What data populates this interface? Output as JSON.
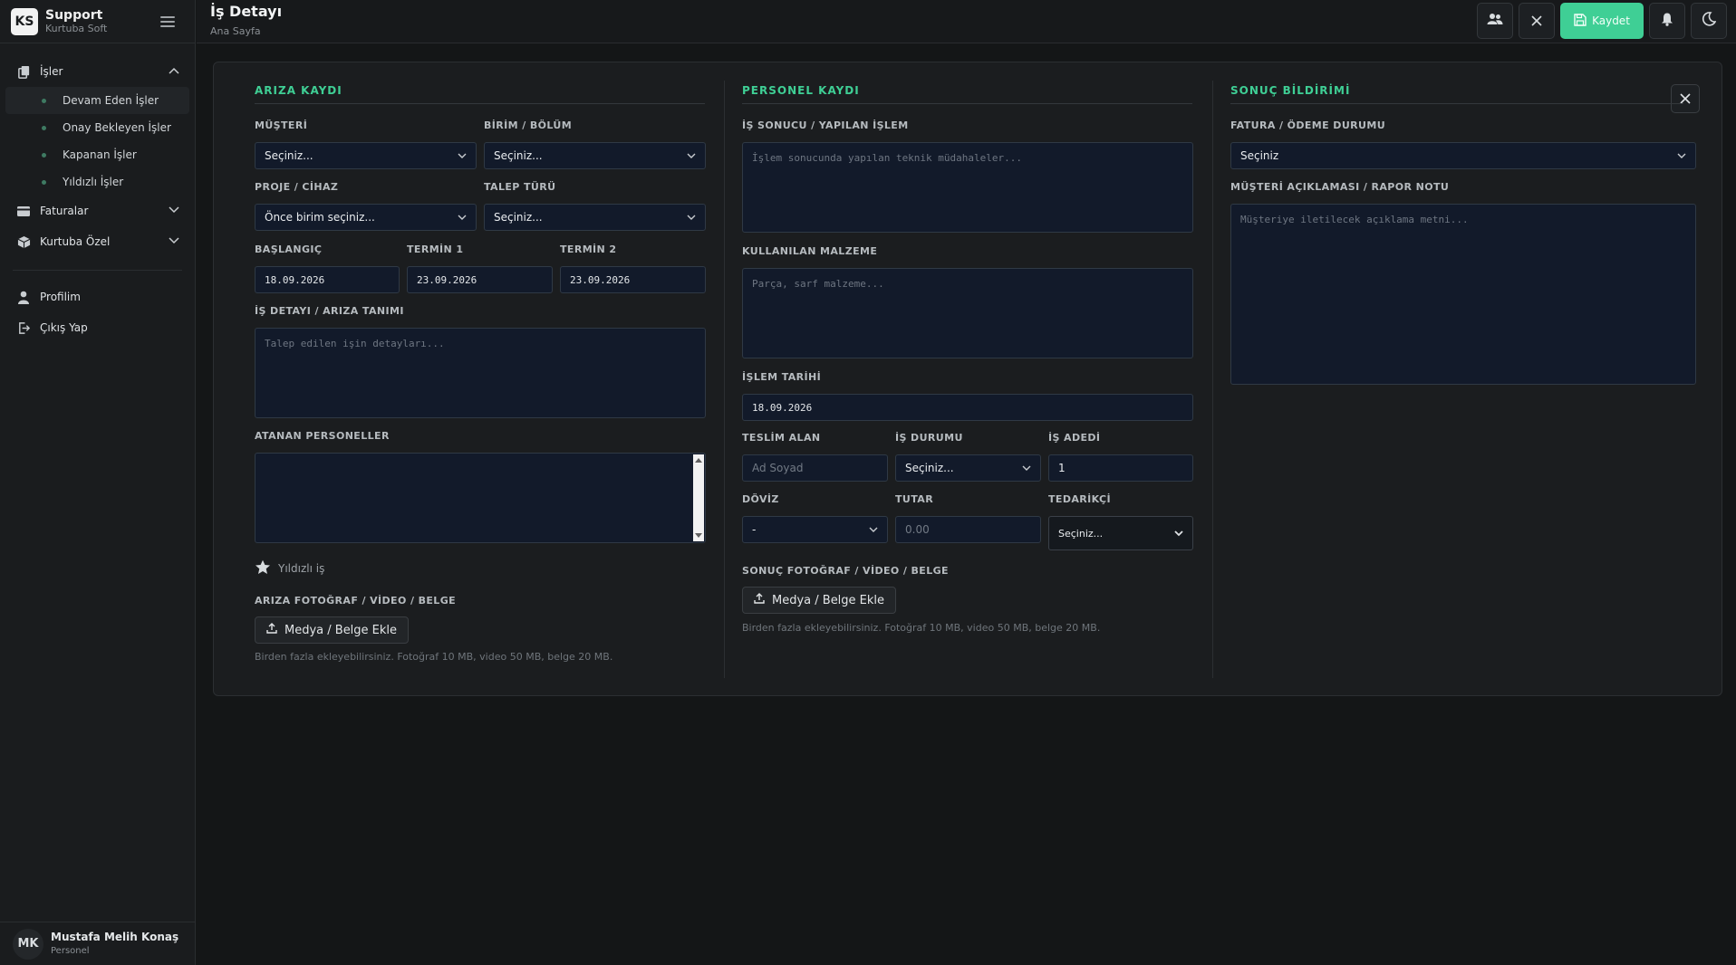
{
  "brand": {
    "title": "Support",
    "subtitle": "Kurtuba Soft",
    "logo_letters": "KS"
  },
  "sidebar": {
    "groups": [
      {
        "label": "İşler",
        "icon": "documents-icon",
        "expanded": true,
        "items": [
          "Devam Eden İşler",
          "Onay Bekleyen İşler",
          "Kapanan İşler",
          "Yıldızlı İşler"
        ]
      },
      {
        "label": "Faturalar",
        "icon": "credit-card-icon",
        "expanded": false
      },
      {
        "label": "Kurtuba Özel",
        "icon": "box-icon",
        "expanded": false
      }
    ],
    "links": [
      {
        "label": "Profilim",
        "icon": "user-icon"
      },
      {
        "label": "Çıkış Yap",
        "icon": "logout-icon"
      }
    ]
  },
  "user": {
    "initials": "MK",
    "name": "Mustafa Melih Konaş",
    "role": "Personel"
  },
  "header": {
    "title": "İş Detayı",
    "breadcrumb": "Ana Sayfa",
    "save_label": "Kaydet"
  },
  "colors": {
    "accent": "#3fcf95",
    "field_bg": "#121a2a",
    "background": "#141617"
  },
  "ariza": {
    "section": "ARIZA KAYDI",
    "musteri_label": "MÜŞTERİ",
    "musteri_value": "Seçiniz...",
    "birim_label": "BİRİM / BÖLÜM",
    "birim_value": "Seçiniz...",
    "proje_label": "PROJE / CİHAZ",
    "proje_value": "Önce birim seçiniz...",
    "talep_label": "TALEP TÜRÜ",
    "talep_value": "Seçiniz...",
    "baslangic_label": "BAŞLANGIÇ",
    "baslangic_value": "18.09.2026",
    "termin1_label": "TERMİN 1",
    "termin1_value": "23.09.2026",
    "termin2_label": "TERMİN 2",
    "termin2_value": "23.09.2026",
    "detay_label": "İŞ DETAYI / ARIZA TANIMI",
    "detay_placeholder": "Talep edilen işin detayları...",
    "personel_label": "ATANAN PERSONELLER",
    "yildizli_label": "Yıldızlı iş",
    "foto_label": "ARIZA FOTOĞRAF / VİDEO / BELGE",
    "media_button": "Medya / Belge Ekle",
    "note": "Birden fazla ekleyebilirsiniz. Fotoğraf 10 MB, video 50 MB, belge 20 MB."
  },
  "personel": {
    "section": "PERSONEL KAYDI",
    "sonuc_label": "İŞ SONUCU / YAPILAN İŞLEM",
    "sonuc_placeholder": "İşlem sonucunda yapılan teknik müdahaleler...",
    "malzeme_label": "KULLANILAN MALZEME",
    "malzeme_placeholder": "Parça, sarf malzeme...",
    "tarih_label": "İŞLEM TARİHİ",
    "tarih_value": "18.09.2026",
    "teslim_label": "TESLİM ALAN",
    "teslim_placeholder": "Ad Soyad",
    "durum_label": "İŞ DURUMU",
    "durum_value": "Seçiniz...",
    "adet_label": "İŞ ADEDİ",
    "adet_value": "1",
    "doviz_label": "DÖVİZ",
    "doviz_value": "-",
    "tutar_label": "TUTAR",
    "tutar_placeholder": "0.00",
    "tedarikci_label": "TEDARİKÇİ",
    "tedarikci_value": "Seçiniz...",
    "foto_label": "SONUÇ FOTOĞRAF / VİDEO / BELGE",
    "media_button": "Medya / Belge Ekle",
    "note": "Birden fazla ekleyebilirsiniz. Fotoğraf 10 MB, video 50 MB, belge 20 MB."
  },
  "sonuc": {
    "section": "SONUÇ BİLDİRİMİ",
    "fatura_label": "FATURA / ÖDEME DURUMU",
    "fatura_value": "Seçiniz",
    "aciklama_label": "MÜŞTERİ AÇIKLAMASI / RAPOR NOTU",
    "aciklama_placeholder": "Müşteriye iletilecek açıklama metni..."
  }
}
